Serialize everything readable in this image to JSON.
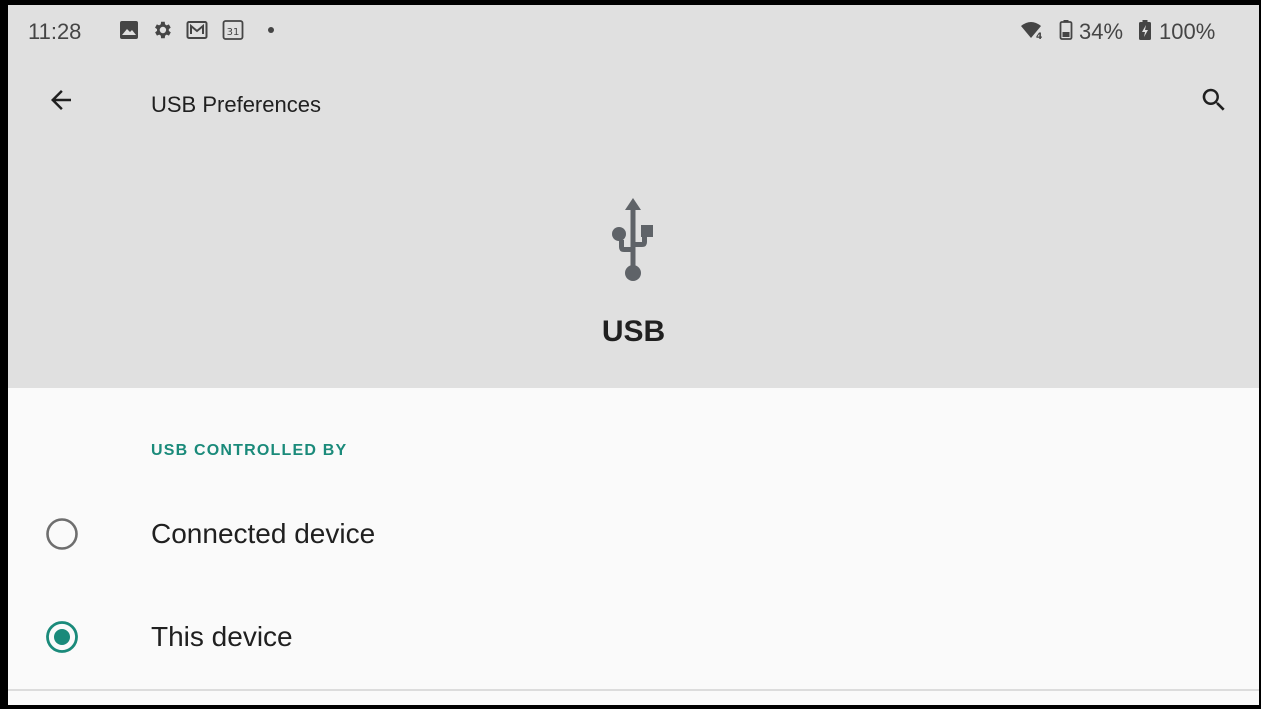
{
  "status_bar": {
    "time": "11:28",
    "left_icons": [
      "image-icon",
      "gear-icon",
      "mail-icon",
      "calendar-icon",
      "dot-icon"
    ],
    "calendar_day": "31",
    "wifi_badge": "4",
    "phone_battery": "34%",
    "battery": "100%"
  },
  "app_bar": {
    "title": "USB Preferences",
    "back_icon": "arrow-back-icon",
    "search_icon": "search-icon"
  },
  "hero": {
    "icon": "usb-icon",
    "label": "USB"
  },
  "section": {
    "header": "USB CONTROLLED BY"
  },
  "options": [
    {
      "label": "Connected device",
      "selected": false
    },
    {
      "label": "This device",
      "selected": true
    }
  ],
  "colors": {
    "accent": "#1a8a7a",
    "header_bg": "#e0e0e0",
    "content_bg": "#fafafa",
    "text_primary": "#202020",
    "icon_gray": "#5f6368"
  }
}
